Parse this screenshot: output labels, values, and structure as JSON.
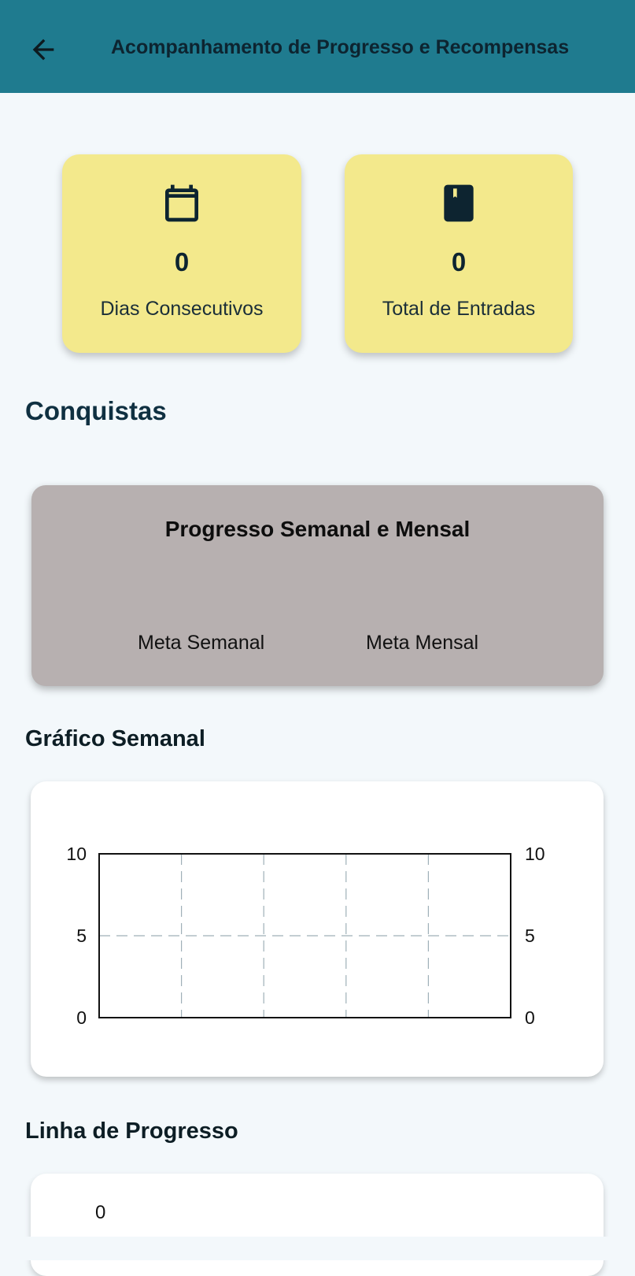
{
  "header": {
    "title": "Acompanhamento de Progresso e Recompensas",
    "back_icon": "arrow-left-icon",
    "background": "#1f7b8f"
  },
  "stats": [
    {
      "icon": "calendar-icon",
      "value": "0",
      "label": "Dias Consecutivos"
    },
    {
      "icon": "book-icon",
      "value": "0",
      "label": "Total de Entradas"
    }
  ],
  "stats_card_color": "#f3e98c",
  "achievements": {
    "title": "Conquistas"
  },
  "progress": {
    "title": "Progresso Semanal e Mensal",
    "weekly_label": "Meta Semanal",
    "monthly_label": "Meta Mensal",
    "card_color": "#b7b0b0"
  },
  "weekly_chart": {
    "title": "Gráfico Semanal"
  },
  "chart_data": {
    "type": "bar",
    "categories": [],
    "series": [],
    "ylim": [
      0,
      10
    ],
    "y_ticks_left": [
      "0",
      "5",
      "10"
    ],
    "y_ticks_right": [
      "0",
      "5",
      "10"
    ],
    "grid": true,
    "title": "",
    "xlabel": "",
    "ylabel": ""
  },
  "timeline": {
    "title": "Linha de Progresso",
    "value": "0"
  }
}
